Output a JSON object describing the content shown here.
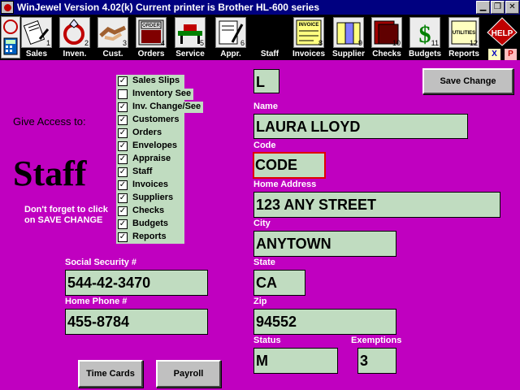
{
  "titlebar": {
    "title": "WinJewel Version 4.02(k)   Current printer is Brother HL-600 series",
    "minimize": "▁",
    "restore": "❐",
    "close": "✕"
  },
  "toolbar": {
    "items": [
      {
        "label": "Sales",
        "num": "1",
        "icon": "sales-slip-icon"
      },
      {
        "label": "Inven.",
        "num": "2",
        "icon": "ring-icon"
      },
      {
        "label": "Cust.",
        "num": "3",
        "icon": "handshake-icon"
      },
      {
        "label": "Orders",
        "num": "4",
        "icon": "order-book-icon"
      },
      {
        "label": "Service",
        "num": "5",
        "icon": "service-bench-icon"
      },
      {
        "label": "Appr.",
        "num": "6",
        "icon": "appraisal-icon"
      },
      {
        "label": "Staff",
        "num": "",
        "icon": "staff-icon"
      },
      {
        "label": "Invoices",
        "num": "8",
        "icon": "invoice-icon"
      },
      {
        "label": "Supplier",
        "num": "9",
        "icon": "supplier-icon"
      },
      {
        "label": "Checks",
        "num": "10",
        "icon": "checks-icon"
      },
      {
        "label": "Budgets",
        "num": "11",
        "icon": "budget-dollar-icon"
      },
      {
        "label": "Reports",
        "num": "12",
        "icon": "utilities-icon"
      }
    ],
    "help_label": "HELP",
    "x_label": "X",
    "p_label": "P",
    "invoice_text": "INVOICE",
    "order_text": "ORDER",
    "utilities_text": "UTILITIES"
  },
  "access": {
    "give_access_label": "Give Access to:",
    "heading": "Staff",
    "reminder": "Don't forget to click on SAVE CHANGE",
    "items": [
      {
        "label": "Sales Slips",
        "checked": true
      },
      {
        "label": "Inventory See",
        "checked": false
      },
      {
        "label": "Inv. Change/See",
        "checked": true
      },
      {
        "label": "Customers",
        "checked": true
      },
      {
        "label": "Orders",
        "checked": true
      },
      {
        "label": "Envelopes",
        "checked": true
      },
      {
        "label": "Appraise",
        "checked": true
      },
      {
        "label": "Staff",
        "checked": true
      },
      {
        "label": "Invoices",
        "checked": true
      },
      {
        "label": "Suppliers",
        "checked": true
      },
      {
        "label": "Checks",
        "checked": true
      },
      {
        "label": "Budgets",
        "checked": true
      },
      {
        "label": "Reports",
        "checked": true
      }
    ]
  },
  "form": {
    "initial": "L",
    "save_button": "Save Change",
    "name_label": "Name",
    "name": "LAURA LLOYD",
    "code_label": "Code",
    "code": "CODE",
    "address_label": "Home Address",
    "address": "123 ANY STREET",
    "city_label": "City",
    "city": "ANYTOWN",
    "state_label": "State",
    "state": "CA",
    "zip_label": "Zip",
    "zip": "94552",
    "status_label": "Status",
    "status": "M",
    "exemptions_label": "Exemptions",
    "exemptions": "3",
    "ssn_label": "Social Security #",
    "ssn": "544-42-3470",
    "phone_label": "Home Phone #",
    "phone": "455-8784",
    "time_cards_button": "Time Cards",
    "payroll_button": "Payroll"
  }
}
